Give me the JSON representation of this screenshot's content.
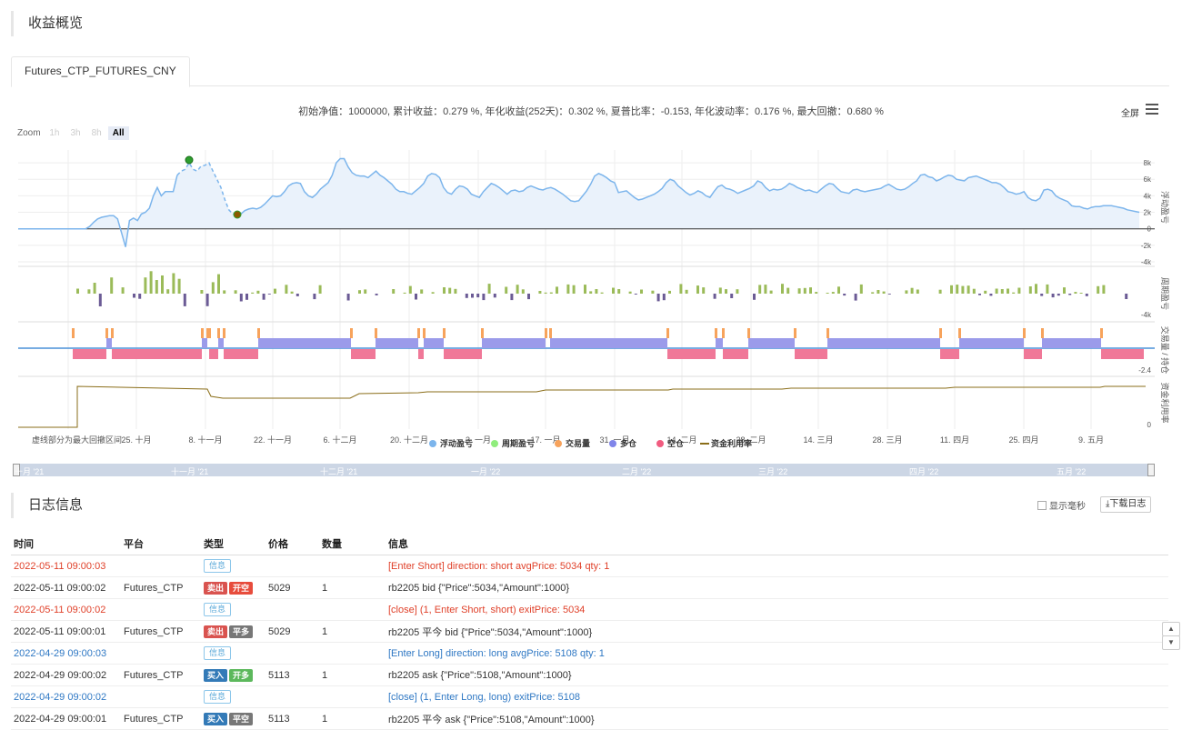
{
  "overview": {
    "title": "收益概览"
  },
  "tab": {
    "label": "Futures_CTP_FUTURES_CNY"
  },
  "summary": "初始净值：1000000, 累计收益：0.279 %, 年化收益(252天)：0.302 %, 夏普比率：-0.153, 年化波动率：0.176 %, 最大回撤：0.680 %",
  "toolbar": {
    "fullscreen": "全屏",
    "menu_icon": "menu-icon"
  },
  "zoom": {
    "label": "Zoom",
    "buttons": [
      "1h",
      "3h",
      "8h",
      "All"
    ],
    "active": "All"
  },
  "chart_data": {
    "type": "line",
    "x_tick_labels": [
      "25. 十月",
      "8. 十一月",
      "22. 十一月",
      "6. 十二月",
      "20. 十二月",
      "3. 一月",
      "17. 一月",
      "31. 一月",
      "14. 二月",
      "28. 二月",
      "14. 三月",
      "28. 三月",
      "11. 四月",
      "25. 四月",
      "9. 五月"
    ],
    "annotation": "虚线部分为最大回撤区间",
    "panels": [
      {
        "name": "浮动盈亏",
        "y_ticks": [
          "8k",
          "6k",
          "4k",
          "2k",
          "0",
          "-2k",
          "-4k"
        ],
        "ylim": [
          -4000,
          9000
        ],
        "values": [
          0,
          0,
          0,
          0,
          0,
          0,
          0,
          0,
          0,
          0,
          0,
          0,
          0,
          0,
          0,
          0,
          0,
          0,
          300,
          800,
          1200,
          1400,
          1500,
          1600,
          1600,
          1200,
          -500,
          -2200,
          1000,
          1300,
          1000,
          1800,
          2000,
          2500,
          4000,
          5000,
          4000,
          4500,
          4500,
          4500,
          6500,
          7000,
          7200,
          8000,
          7200,
          7000,
          7600,
          7700,
          8000,
          7000,
          6000,
          5000,
          3500,
          2300,
          1800,
          1900,
          1800,
          2200,
          2400,
          2500,
          2400,
          2600,
          3000,
          3500,
          4000,
          3900,
          4000,
          4500,
          5200,
          5500,
          5600,
          5500,
          4500,
          4000,
          3800,
          4200,
          4800,
          5200,
          5600,
          6500,
          8000,
          8500,
          8500,
          7500,
          6800,
          6500,
          6400,
          6400,
          6200,
          6600,
          7000,
          6500,
          6200,
          5800,
          5400,
          4800,
          4500,
          4500,
          4300,
          4200,
          4600,
          5000,
          5500,
          6400,
          6700,
          6600,
          6200,
          5000,
          4400,
          4200,
          4800,
          5200,
          5100,
          4800,
          4200,
          4000,
          3800,
          4500,
          5000,
          5500,
          5300,
          5000,
          4600,
          4200,
          4600,
          4700,
          4500,
          4600,
          5000,
          5200,
          5000,
          4800,
          4700,
          4900,
          5000,
          4800,
          4500,
          4200,
          3800,
          3400,
          3300,
          3400,
          4000,
          4600,
          5400,
          6400,
          6700,
          6500,
          6200,
          5800,
          5600,
          4400,
          4500,
          4600,
          4200,
          3800,
          3500,
          3600,
          3800,
          4000,
          4200,
          4500,
          4900,
          5600,
          6000,
          5800,
          5200,
          4800,
          4400,
          4100,
          4300,
          4600,
          4400,
          4000,
          3800,
          4500,
          5100,
          5300,
          4900,
          4800,
          4600,
          4300,
          4500,
          4700,
          4900,
          5200,
          5800,
          5600,
          5000,
          4600,
          4800,
          4700,
          4800,
          5100,
          5500,
          5300,
          5000,
          4800,
          4600,
          4700,
          4500,
          4400,
          4800,
          5200,
          5500,
          5400,
          4900,
          4500,
          4400,
          4300,
          4700,
          4800,
          4600,
          4500,
          4600,
          4700,
          4800,
          4900,
          5200,
          5400,
          5100,
          4800,
          4700,
          4800,
          5100,
          5500,
          5800,
          6500,
          6600,
          6300,
          6200,
          5800,
          6000,
          6300,
          6500,
          6400,
          6000,
          5900,
          5800,
          6200,
          6300,
          6400,
          6200,
          6000,
          5800,
          5600,
          5600,
          5400,
          5000,
          4500,
          4400,
          4200,
          4300,
          4500,
          3800,
          3500,
          3400,
          3700,
          4700,
          4800,
          4600,
          4000,
          3700,
          3500,
          3300,
          2800,
          2700,
          2700,
          2500,
          2400,
          2600,
          2700,
          2700,
          2800,
          2800,
          2800,
          2700,
          2600,
          2500,
          2300,
          2200,
          2100,
          2000
        ]
      },
      {
        "name": "周期盈亏",
        "y_ticks": [
          "-4k"
        ]
      },
      {
        "name": "交易量 / 持仓",
        "y_ticks": [
          "-2.4"
        ]
      },
      {
        "name": "资金利用率",
        "y_ticks": [
          "0"
        ]
      }
    ],
    "legend": [
      {
        "name": "浮动盈亏",
        "color": "#7cb5ec"
      },
      {
        "name": "周期盈亏",
        "color": "#90ed7d"
      },
      {
        "name": "交易量",
        "color": "#f7a35c"
      },
      {
        "name": "多仓",
        "color": "#8085e9"
      },
      {
        "name": "空仓",
        "color": "#f15c80"
      },
      {
        "name": "资金利用率",
        "color": "#8a6d18"
      }
    ],
    "grid": true
  },
  "navigator": {
    "labels": [
      "十月 '21",
      "十一月 '21",
      "十二月 '21",
      "一月 '22",
      "二月 '22",
      "三月 '22",
      "四月 '22",
      "五月 '22"
    ]
  },
  "log": {
    "title": "日志信息",
    "show_ms": "显示毫秒",
    "download": "下载日志",
    "headers": [
      "时间",
      "平台",
      "类型",
      "价格",
      "数量",
      "信息"
    ],
    "rows": [
      {
        "time": "2022-05-11 09:00:03",
        "platform": "",
        "type": [
          "信息"
        ],
        "price": "",
        "qty": "",
        "info": "[Enter Short] direction: short avgPrice: 5034 qty: 1",
        "color": "red"
      },
      {
        "time": "2022-05-11 09:00:02",
        "platform": "Futures_CTP",
        "type": [
          "卖出",
          "开空"
        ],
        "price": "5029",
        "qty": "1",
        "info": "rb2205 bid {\"Price\":5034,\"Amount\":1000}",
        "color": "normal"
      },
      {
        "time": "2022-05-11 09:00:02",
        "platform": "",
        "type": [
          "信息"
        ],
        "price": "",
        "qty": "",
        "info": "[close] (1, Enter Short, short) exitPrice: 5034",
        "color": "red"
      },
      {
        "time": "2022-05-11 09:00:01",
        "platform": "Futures_CTP",
        "type": [
          "卖出",
          "平多"
        ],
        "price": "5029",
        "qty": "1",
        "info": "rb2205 平今 bid {\"Price\":5034,\"Amount\":1000}",
        "color": "normal"
      },
      {
        "time": "2022-04-29 09:00:03",
        "platform": "",
        "type": [
          "信息"
        ],
        "price": "",
        "qty": "",
        "info": "[Enter Long] direction: long avgPrice: 5108 qty: 1",
        "color": "blue"
      },
      {
        "time": "2022-04-29 09:00:02",
        "platform": "Futures_CTP",
        "type": [
          "买入",
          "开多"
        ],
        "price": "5113",
        "qty": "1",
        "info": "rb2205 ask {\"Price\":5108,\"Amount\":1000}",
        "color": "normal"
      },
      {
        "time": "2022-04-29 09:00:02",
        "platform": "",
        "type": [
          "信息"
        ],
        "price": "",
        "qty": "",
        "info": "[close] (1, Enter Long, long) exitPrice: 5108",
        "color": "blue"
      },
      {
        "time": "2022-04-29 09:00:01",
        "platform": "Futures_CTP",
        "type": [
          "买入",
          "平空"
        ],
        "price": "5113",
        "qty": "1",
        "info": "rb2205 平今 ask {\"Price\":5108,\"Amount\":1000}",
        "color": "normal"
      }
    ]
  }
}
